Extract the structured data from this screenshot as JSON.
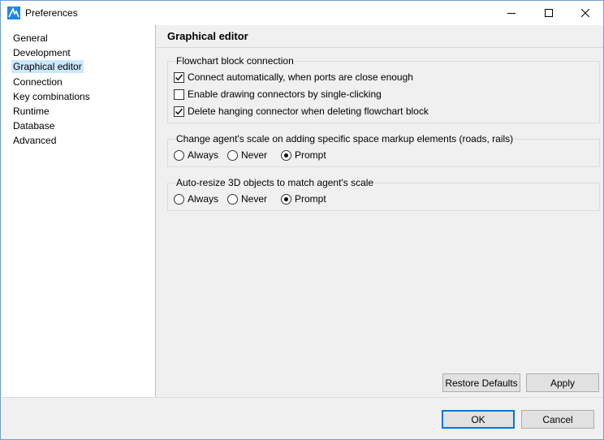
{
  "window": {
    "title": "Preferences",
    "app_icon": "anylogic-logo-icon"
  },
  "nav": {
    "items": [
      {
        "label": "General",
        "selected": false
      },
      {
        "label": "Development",
        "selected": false
      },
      {
        "label": "Graphical editor",
        "selected": true
      },
      {
        "label": "Connection",
        "selected": false
      },
      {
        "label": "Key combinations",
        "selected": false
      },
      {
        "label": "Runtime",
        "selected": false
      },
      {
        "label": "Database",
        "selected": false
      },
      {
        "label": "Advanced",
        "selected": false
      }
    ]
  },
  "panel": {
    "title": "Graphical editor",
    "flowchart_group": {
      "title": "Flowchart block connection",
      "options": [
        {
          "label": "Connect automatically, when ports are close enough",
          "checked": true
        },
        {
          "label": "Enable drawing connectors by single-clicking",
          "checked": false
        },
        {
          "label": "Delete hanging connector when deleting flowchart block",
          "checked": true
        }
      ]
    },
    "scale_group": {
      "title": "Change agent's scale on adding specific space markup elements (roads, rails)",
      "options": [
        "Always",
        "Never",
        "Prompt"
      ],
      "selected": "Prompt"
    },
    "resize_group": {
      "title": "Auto-resize 3D objects to match agent's scale",
      "options": [
        "Always",
        "Never",
        "Prompt"
      ],
      "selected": "Prompt"
    },
    "restore_defaults_label": "Restore Defaults",
    "apply_label": "Apply"
  },
  "footer": {
    "ok_label": "OK",
    "cancel_label": "Cancel"
  },
  "colors": {
    "selection": "#cce8ff",
    "default_button_border": "#0078d7",
    "window_border": "#6f9dd4"
  }
}
